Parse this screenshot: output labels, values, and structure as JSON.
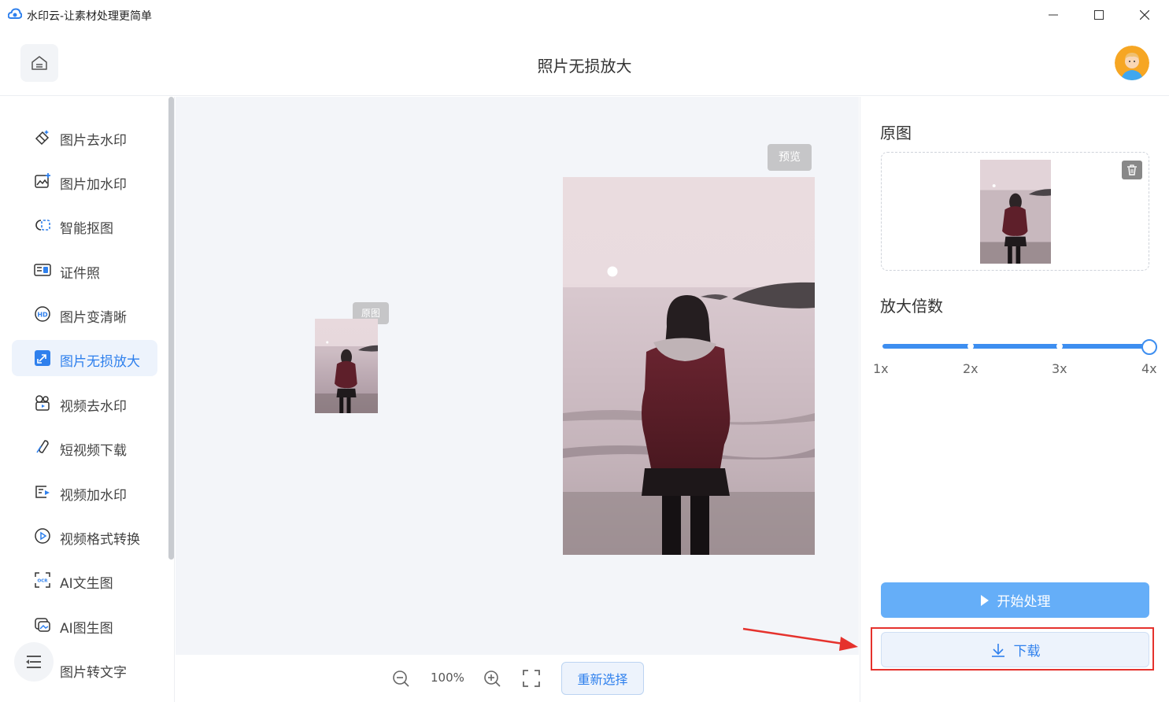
{
  "window": {
    "title": "水印云-让素材处理更简单"
  },
  "header": {
    "page_title": "照片无损放大"
  },
  "sidebar": {
    "items": [
      {
        "label": "图片去水印",
        "icon": "image-remove-watermark-icon",
        "active": false
      },
      {
        "label": "图片加水印",
        "icon": "image-add-watermark-icon",
        "active": false
      },
      {
        "label": "智能抠图",
        "icon": "smart-cutout-icon",
        "active": false
      },
      {
        "label": "证件照",
        "icon": "id-photo-icon",
        "active": false
      },
      {
        "label": "图片变清晰",
        "icon": "hd-icon",
        "active": false
      },
      {
        "label": "图片无损放大",
        "icon": "enlarge-icon",
        "active": true
      },
      {
        "label": "视频去水印",
        "icon": "video-remove-watermark-icon",
        "active": false
      },
      {
        "label": "短视频下载",
        "icon": "short-video-download-icon",
        "active": false
      },
      {
        "label": "视频加水印",
        "icon": "video-add-watermark-icon",
        "active": false
      },
      {
        "label": "视频格式转换",
        "icon": "video-convert-icon",
        "active": false
      },
      {
        "label": "AI文生图",
        "icon": "ai-text-to-image-icon",
        "active": false
      },
      {
        "label": "AI图生图",
        "icon": "ai-image-to-image-icon",
        "active": false
      },
      {
        "label": "图片转文字",
        "icon": "image-to-text-icon",
        "active": false
      }
    ]
  },
  "canvas": {
    "original_tag": "原图",
    "preview_tag": "预览"
  },
  "toolbar": {
    "zoom": "100%",
    "reselect_label": "重新选择"
  },
  "right_panel": {
    "original_title": "原图",
    "scale_title": "放大倍数",
    "scale_ticks": [
      "1x",
      "2x",
      "3x",
      "4x"
    ],
    "scale_selected": "4x",
    "start_label": "开始处理",
    "download_label": "下载"
  },
  "colors": {
    "accent": "#2f80ed",
    "primary_button": "#65aef8",
    "highlight": "#e5322d"
  }
}
